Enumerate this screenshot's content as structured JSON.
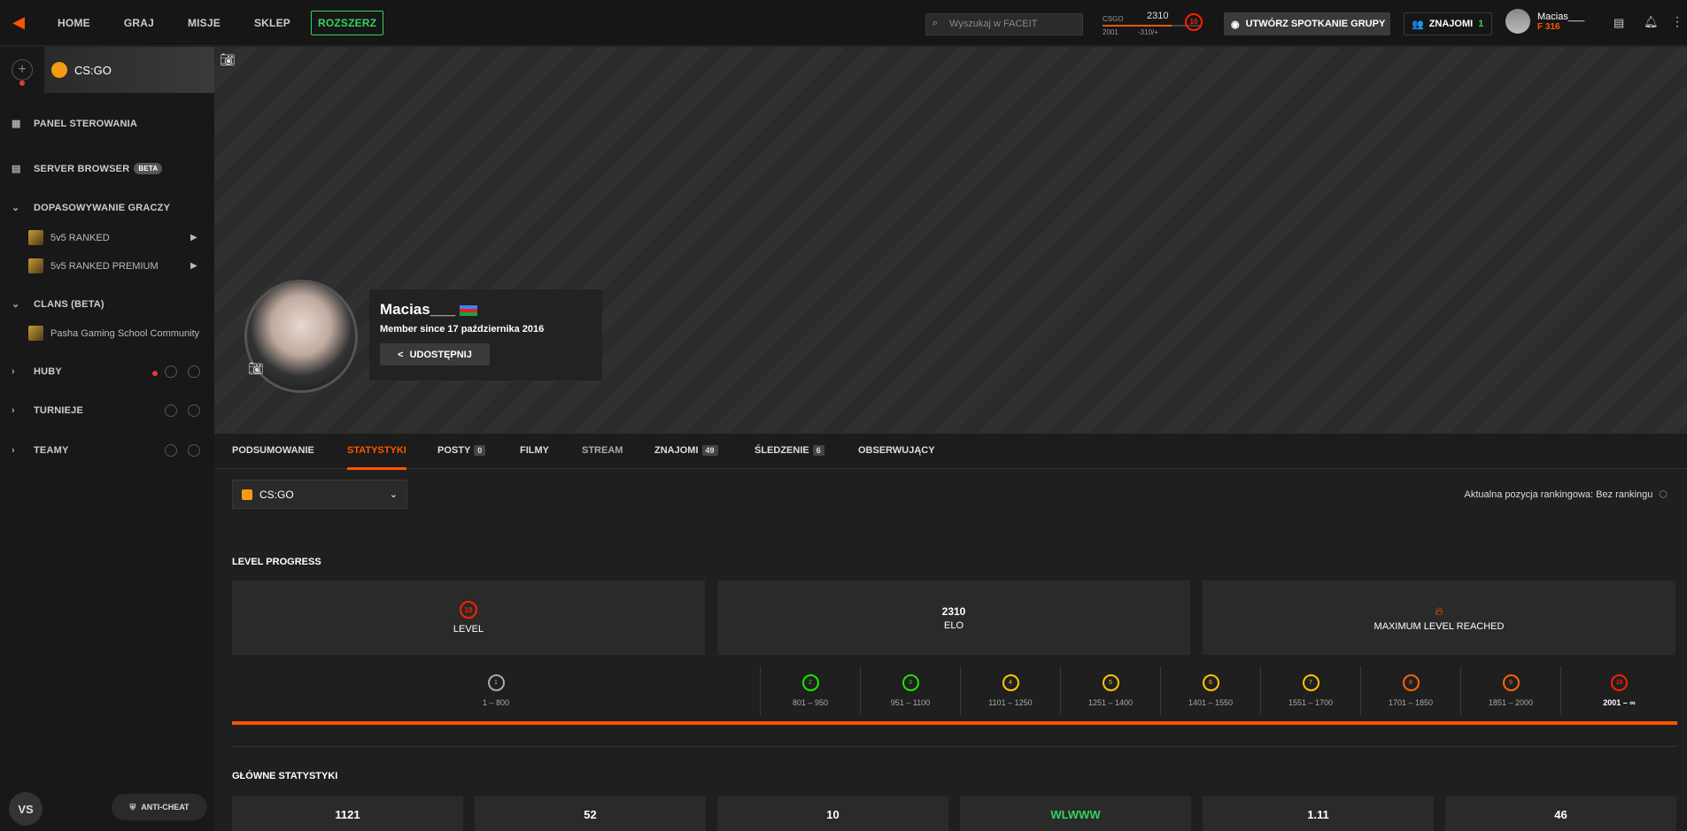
{
  "topnav": {
    "items": [
      "HOME",
      "GRAJ",
      "MISJE",
      "SKLEP"
    ],
    "rozszerz": "ROZSZERZ",
    "search_placeholder": "Wyszukaj w FACEIT",
    "elo_game": "CSGO",
    "elo_value": "2310",
    "elo_min": "2001",
    "elo_diff": "-310/+",
    "level": "10",
    "create_group": "UTWÓRZ SPOTKANIE GRUPY",
    "friends_label": "ZNAJOMI",
    "friends_count": "1",
    "username": "Macias___",
    "points": "316"
  },
  "sidebar": {
    "game": "CS:GO",
    "panel": "PANEL STEROWANIA",
    "server_browser": "SERVER BROWSER",
    "beta": "BETA",
    "matchmaking": "DOPASOWYWANIE GRACZY",
    "ranked": "5v5 RANKED",
    "ranked_premium": "5v5 RANKED PREMIUM",
    "clans": "CLANS (BETA)",
    "clan_name": "Pasha Gaming School Community",
    "huby": "HUBY",
    "turnieje": "TURNIEJE",
    "teamy": "TEAMY",
    "vs": "VS",
    "anticheat": "ANTI-CHEAT"
  },
  "profile": {
    "name": "Macias___",
    "since": "Member since 17 października 2016",
    "share": "UDOSTĘPNIJ"
  },
  "tabs": [
    {
      "label": "PODSUMOWANIE"
    },
    {
      "label": "STATYSTYKI"
    },
    {
      "label": "POSTY",
      "count": "0"
    },
    {
      "label": "FILMY"
    },
    {
      "label": "STREAM"
    },
    {
      "label": "ZNAJOMI",
      "count": "49"
    },
    {
      "label": "ŚLEDZENIE",
      "count": "6"
    },
    {
      "label": "OBSERWUJĄCY"
    }
  ],
  "stats": {
    "game_select": "CS:GO",
    "ranking": "Aktualna pozycja rankingowa: Bez rankingu",
    "level_progress": "LEVEL PROGRESS",
    "level_value": "10",
    "level_label": "LEVEL",
    "elo_value": "2310",
    "elo_label": "ELO",
    "max_level": "MAXIMUM LEVEL REACHED",
    "ranges": [
      {
        "lvl": "1",
        "range": "1 – 800",
        "color": "#aaaaaa"
      },
      {
        "lvl": "2",
        "range": "801 – 950",
        "color": "#1ce400"
      },
      {
        "lvl": "3",
        "range": "951 – 1100",
        "color": "#1ce400"
      },
      {
        "lvl": "4",
        "range": "1101 – 1250",
        "color": "#ffc800"
      },
      {
        "lvl": "5",
        "range": "1251 – 1400",
        "color": "#ffc800"
      },
      {
        "lvl": "6",
        "range": "1401 – 1550",
        "color": "#ffc800"
      },
      {
        "lvl": "7",
        "range": "1551 – 1700",
        "color": "#ffc800"
      },
      {
        "lvl": "8",
        "range": "1701 – 1850",
        "color": "#ff6309"
      },
      {
        "lvl": "9",
        "range": "1851 – 2000",
        "color": "#ff6309"
      },
      {
        "lvl": "10",
        "range": "2001 – ∞",
        "color": "#fe1f00"
      }
    ],
    "main_stats": "GŁÓWNE STATYSTYKI",
    "values": [
      "1121",
      "52",
      "10",
      "WLWWW",
      "1.11",
      "46"
    ]
  }
}
